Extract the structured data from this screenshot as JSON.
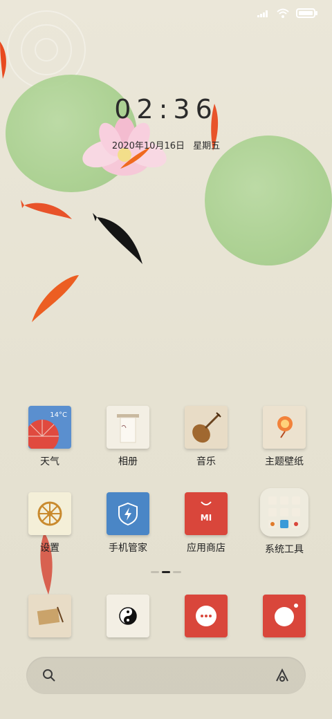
{
  "status_bar": {
    "icons": [
      "signal-icon",
      "wifi-icon",
      "battery-icon"
    ]
  },
  "lockscreen": {
    "time": "02:36",
    "date": "2020年10月16日",
    "weekday": "星期五"
  },
  "apps": [
    {
      "label": "天气",
      "icon": "weather-umbrella-icon",
      "badge": "14°C"
    },
    {
      "label": "相册",
      "icon": "gallery-icon"
    },
    {
      "label": "音乐",
      "icon": "pipa-icon"
    },
    {
      "label": "主题壁纸",
      "icon": "lantern-icon"
    },
    {
      "label": "设置",
      "icon": "wheel-icon"
    },
    {
      "label": "手机管家",
      "icon": "shield-bolt-icon"
    },
    {
      "label": "应用商店",
      "icon": "mi-store-icon",
      "store_mark": "MI"
    },
    {
      "label": "系统工具",
      "icon": "folder-icon"
    }
  ],
  "dock": [
    {
      "icon": "scroll-icon"
    },
    {
      "icon": "yin-yang-icon"
    },
    {
      "icon": "messaging-icon"
    },
    {
      "icon": "camera-icon"
    }
  ],
  "page_indicator": {
    "pages": 3,
    "active": 2
  },
  "search": {
    "left_icon": "search-icon",
    "right_icon": "assistant-icon"
  },
  "colors": {
    "accent_red": "#d9463b",
    "blue": "#4a86c6",
    "lily_green": "#a6cf8c"
  }
}
